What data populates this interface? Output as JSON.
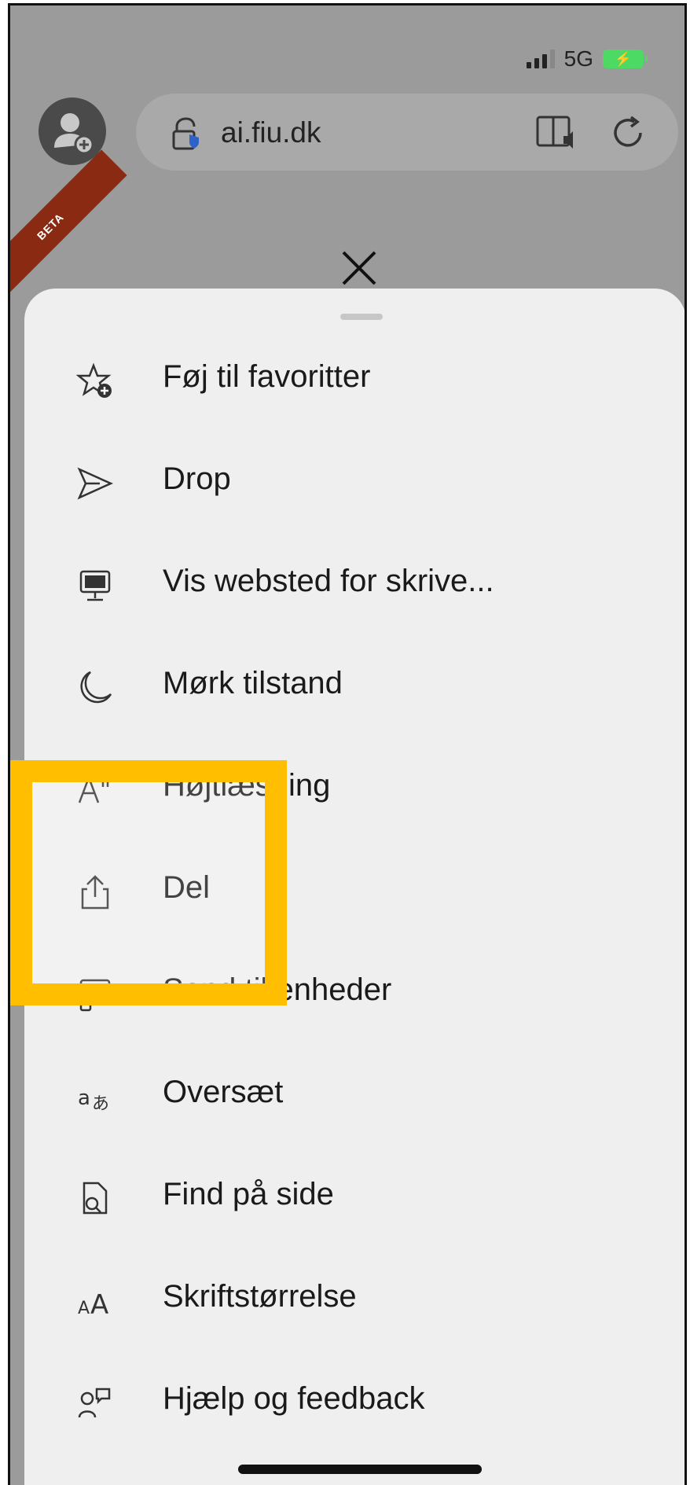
{
  "status_bar": {
    "network": "5G"
  },
  "browser": {
    "url": "ai.fiu.dk",
    "beta_label": "BETA",
    "accent_color": "#2f62c9"
  },
  "menu": {
    "items": [
      {
        "label": "Føj til favoritter",
        "icon": "star-plus-icon"
      },
      {
        "label": "Drop",
        "icon": "send-icon"
      },
      {
        "label": "Vis websted for skrive...",
        "icon": "desktop-icon"
      },
      {
        "label": "Mørk tilstand",
        "icon": "moon-icon"
      },
      {
        "label": "Højtlæsning",
        "icon": "read-aloud-icon"
      },
      {
        "label": "Del",
        "icon": "share-icon"
      },
      {
        "label": "Send til enheder",
        "icon": "device-icon"
      },
      {
        "label": "Oversæt",
        "icon": "translate-icon"
      },
      {
        "label": "Find på side",
        "icon": "find-icon"
      },
      {
        "label": "Skriftstørrelse",
        "icon": "font-size-icon"
      },
      {
        "label": "Hjælp og feedback",
        "icon": "help-feedback-icon"
      }
    ]
  },
  "annotation": {
    "highlight_color": "#ffbe00",
    "highlighted_item": "Del"
  }
}
